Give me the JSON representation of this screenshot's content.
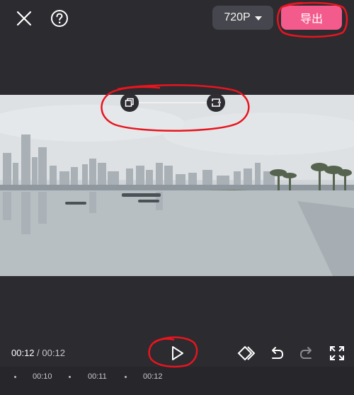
{
  "toolbar": {
    "close_icon": "close-icon",
    "help_icon": "help-icon",
    "resolution_label": "720P",
    "export_label": "导出"
  },
  "player": {
    "current_time": "00:12",
    "separator": "/",
    "total_time": "00:12",
    "play_icon": "play-icon"
  },
  "edit_tools": [
    "keyframe-icon",
    "undo-icon",
    "redo-icon",
    "fullscreen-icon"
  ],
  "timeline": {
    "ticks": [
      "00:10",
      "00:11",
      "00:12"
    ]
  },
  "colors": {
    "background": "#2b2b30",
    "accent": "#f45b8d",
    "annotation": "#e8151f"
  }
}
